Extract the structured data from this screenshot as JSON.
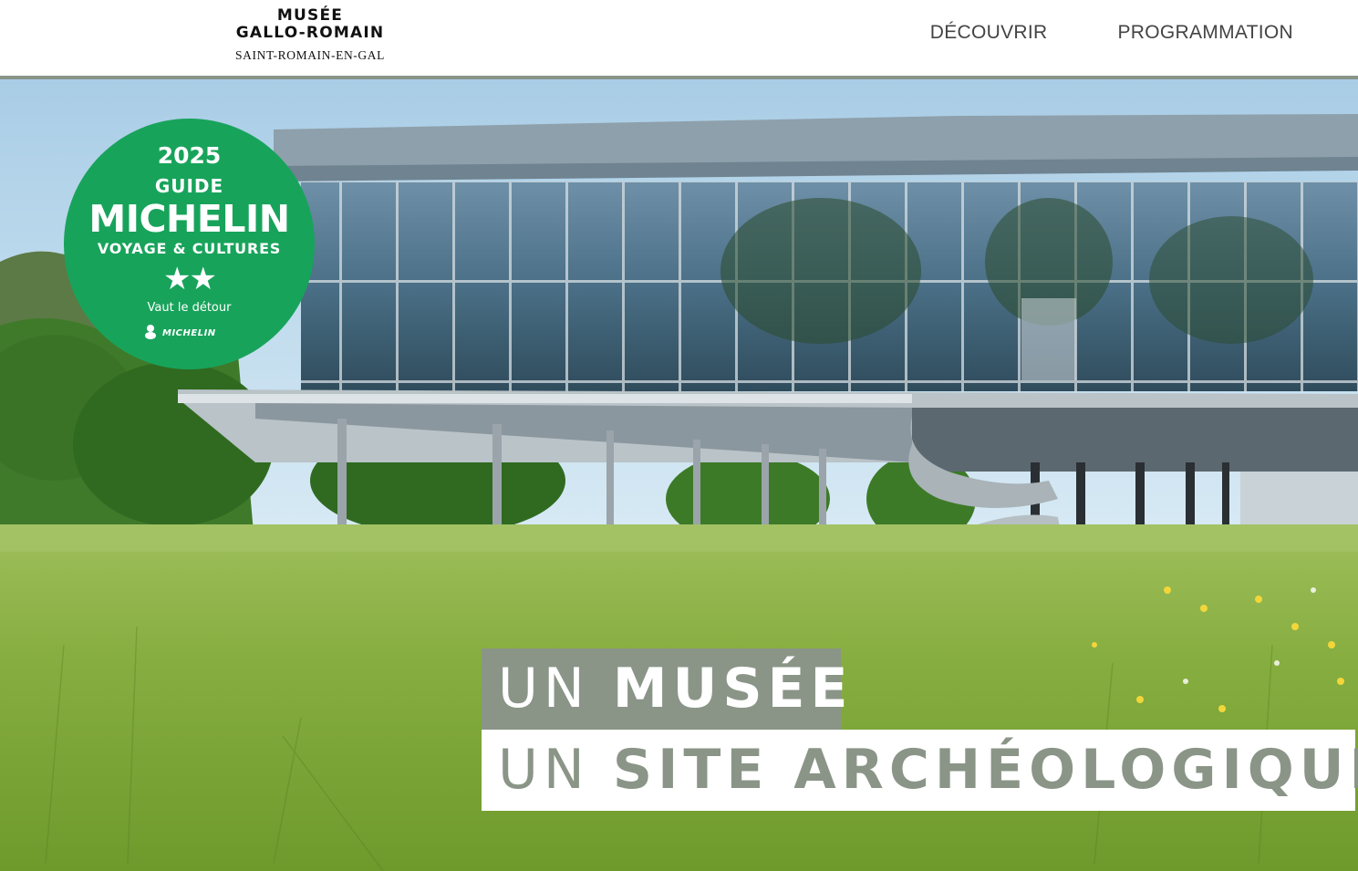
{
  "header": {
    "logo": {
      "line1": "MUSÉE",
      "line2": "GALLO-ROMAIN",
      "line3": "SAINT-ROMAIN-EN-GAL"
    },
    "nav": [
      {
        "label": "DÉCOUVRIR"
      },
      {
        "label": "PROGRAMMATION"
      }
    ]
  },
  "badge": {
    "year": "2025",
    "guide": "GUIDE",
    "brand": "MICHELIN",
    "subtitle": "VOYAGE & CULTURES",
    "stars": "★★",
    "rating_text": "Vaut le détour",
    "footer_brand": "MICHELIN",
    "color": "#18a35b"
  },
  "hero": {
    "title_line1": {
      "light": "UN",
      "bold": "MUSÉE"
    },
    "title_line2": {
      "light": "UN",
      "bold": "SITE ARCHÉOLOGIQUE"
    }
  },
  "colors": {
    "accent_sage": "#8a9587",
    "nav_text": "#444444"
  }
}
